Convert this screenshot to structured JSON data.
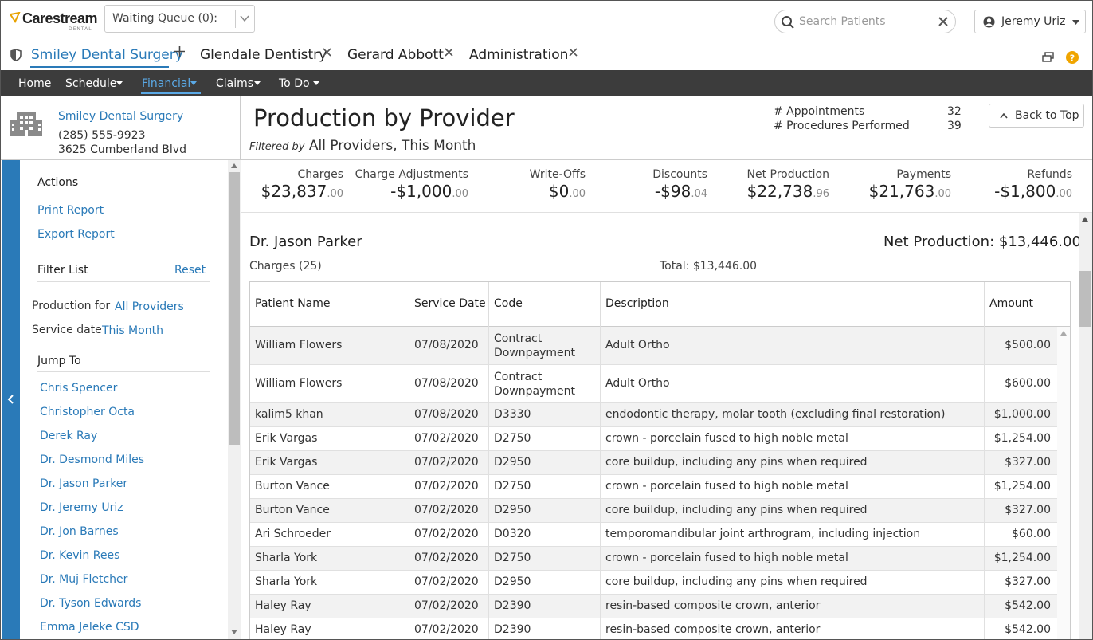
{
  "app": {
    "logo_text": "Carestream",
    "logo_sub": "DENTAL",
    "queue_label": "Waiting Queue (0):",
    "search_placeholder": "Search Patients",
    "user_name": "Jeremy Uriz"
  },
  "tabs": [
    {
      "label": "Smiley Dental Surgery",
      "active": true
    },
    {
      "label": "Glendale Dentistry"
    },
    {
      "label": "Gerard Abbott"
    },
    {
      "label": "Administration"
    }
  ],
  "menu": [
    {
      "label": "Home"
    },
    {
      "label": "Schedule"
    },
    {
      "label": "Financial",
      "active": true
    },
    {
      "label": "Claims"
    },
    {
      "label": "To Do"
    }
  ],
  "office": {
    "name": "Smiley Dental Surgery",
    "phone": "(285) 555-9923",
    "address": "3625 Cumberland Blvd"
  },
  "sidebar": {
    "actions_heading": "Actions",
    "print_report": "Print Report",
    "export_report": "Export Report",
    "filter_heading": "Filter List",
    "reset": "Reset",
    "production_for_label": "Production for",
    "production_for_value": "All Providers",
    "service_date_label": "Service date",
    "service_date_value": "This Month",
    "jump_heading": "Jump To",
    "jump_items": [
      "Chris Spencer",
      "Christopher Octa",
      "Derek Ray",
      "Dr. Desmond Miles",
      "Dr. Jason Parker",
      "Dr. Jeremy Uriz",
      "Dr. Jon Barnes",
      "Dr. Kevin Rees",
      "Dr. Muj Fletcher",
      "Dr. Tyson Edwards",
      "Emma Jeleke CSD"
    ]
  },
  "report": {
    "title": "Production by Provider",
    "filtered_by_label": "Filtered by",
    "filtered_by_value": "All Providers, This Month",
    "appointments_label": "# Appointments",
    "appointments_value": "32",
    "procedures_label": "# Procedures Performed",
    "procedures_value": "39",
    "back_to_top": "Back to Top"
  },
  "summary": [
    {
      "label": "Charges",
      "main": "$23,837",
      "cents": ".00"
    },
    {
      "label": "Charge Adjustments",
      "main": "-$1,000",
      "cents": ".00"
    },
    {
      "label": "Write-Offs",
      "main": "$0",
      "cents": ".00"
    },
    {
      "label": "Discounts",
      "main": "-$98",
      "cents": ".04"
    },
    {
      "label": "Net Production",
      "main": "$22,738",
      "cents": ".96"
    },
    {
      "label": "Payments",
      "main": "$21,763",
      "cents": ".00"
    },
    {
      "label": "Refunds",
      "main": "-$1,800",
      "cents": ".00"
    }
  ],
  "provider": {
    "name": "Dr. Jason Parker",
    "net_production": "Net Production: $13,446.00",
    "charges_label": "Charges (25)",
    "total_label": "Total: $13,446.00"
  },
  "table": {
    "headers": [
      "Patient Name",
      "Service Date",
      "Code",
      "Description",
      "Amount"
    ],
    "rows": [
      [
        "William Flowers",
        "07/08/2020",
        "Contract Downpayment",
        "Adult Ortho",
        "$500.00"
      ],
      [
        "William Flowers",
        "07/08/2020",
        "Contract Downpayment",
        "Adult Ortho",
        "$600.00"
      ],
      [
        "kalim5 khan",
        "07/08/2020",
        "D3330",
        "endodontic therapy, molar tooth (excluding final restoration)",
        "$1,000.00"
      ],
      [
        "Erik Vargas",
        "07/02/2020",
        "D2750",
        "crown - porcelain fused to high noble metal",
        "$1,254.00"
      ],
      [
        "Erik Vargas",
        "07/02/2020",
        "D2950",
        "core buildup, including any pins when required",
        "$327.00"
      ],
      [
        "Burton Vance",
        "07/02/2020",
        "D2750",
        "crown - porcelain fused to high noble metal",
        "$1,254.00"
      ],
      [
        "Burton Vance",
        "07/02/2020",
        "D2950",
        "core buildup, including any pins when required",
        "$327.00"
      ],
      [
        "Ari Schroeder",
        "07/02/2020",
        "D0320",
        "temporomandibular joint arthrogram, including injection",
        "$60.00"
      ],
      [
        "Sharla York",
        "07/02/2020",
        "D2750",
        "crown - porcelain fused to high noble metal",
        "$1,254.00"
      ],
      [
        "Sharla York",
        "07/02/2020",
        "D2950",
        "core buildup, including any pins when required",
        "$327.00"
      ],
      [
        "Haley Ray",
        "07/02/2020",
        "D2390",
        "resin-based composite crown, anterior",
        "$542.00"
      ],
      [
        "Haley Ray",
        "07/02/2020",
        "D2390",
        "resin-based composite crown, anterior",
        "$542.00"
      ]
    ]
  },
  "colors": {
    "accent": "#2a7ab8",
    "menubar": "#3c3c3c",
    "row_alt": "#f2f2f2"
  }
}
